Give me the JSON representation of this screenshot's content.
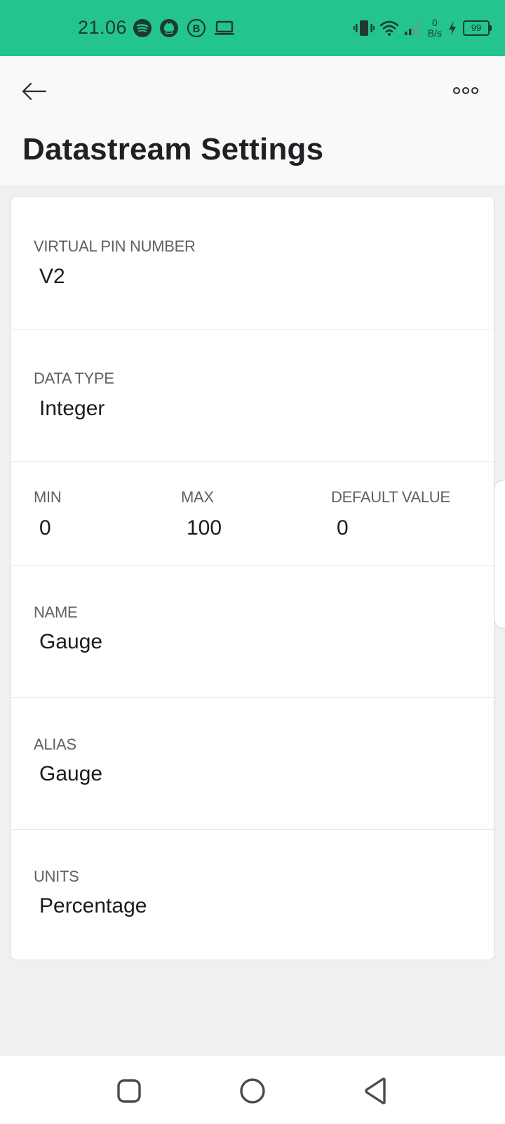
{
  "status_bar": {
    "time": "21.06",
    "net_speed_value": "0",
    "net_speed_unit": "B/s",
    "battery_level": "99",
    "left_icons": [
      "spotify-icon",
      "github-icon",
      "b-circle-icon",
      "laptop-icon"
    ],
    "right_icons": [
      "vibrate-icon",
      "wifi-icon",
      "signal-icon",
      "charging-icon",
      "battery-icon"
    ],
    "background_color": "#23c48e"
  },
  "header": {
    "back_icon": "arrow-left-icon",
    "more_icon": "more-horizontal-icon",
    "title": "Datastream Settings"
  },
  "fields": {
    "virtual_pin": {
      "label": "VIRTUAL PIN NUMBER",
      "value": "V2"
    },
    "data_type": {
      "label": "DATA TYPE",
      "value": "Integer"
    },
    "min": {
      "label": "MIN",
      "value": "0"
    },
    "max": {
      "label": "MAX",
      "value": "100"
    },
    "default_value": {
      "label": "DEFAULT VALUE",
      "value": "0"
    },
    "name": {
      "label": "NAME",
      "value": "Gauge"
    },
    "alias": {
      "label": "ALIAS",
      "value": "Gauge"
    },
    "units": {
      "label": "UNITS",
      "value": "Percentage"
    }
  },
  "nav_bar": {
    "icons": [
      "recents-square-icon",
      "home-circle-icon",
      "back-triangle-icon"
    ]
  }
}
